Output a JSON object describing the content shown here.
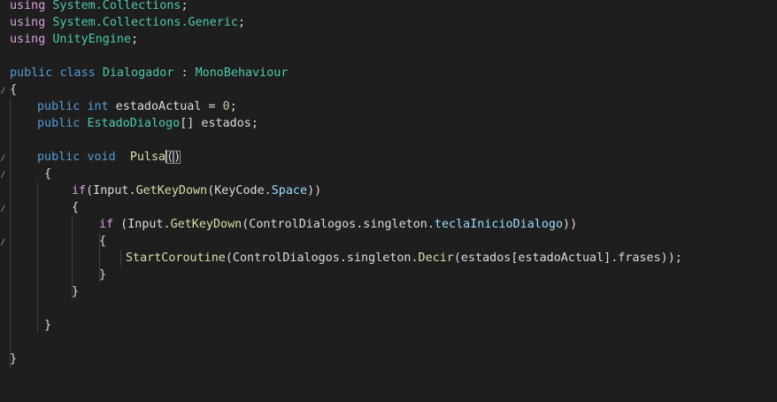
{
  "code": {
    "using_kw": "using",
    "ns1": "System.Collections",
    "ns2": "System.Collections.Generic",
    "ns3": "UnityEngine",
    "semi": ";",
    "public_kw": "public",
    "class_kw": "class",
    "class_name": "Dialogador",
    "colon": " : ",
    "base_class": "MonoBehaviour",
    "open_brace": "{",
    "close_brace": "}",
    "int_kw": "int",
    "field1_rest": " estadoActual = ",
    "field1_value": "0",
    "field2_type": "EstadoDialogo",
    "field2_rest": "[] estados;",
    "void_kw": "void",
    "method_name": "Pulsa",
    "open_paren": "(",
    "close_paren": ")",
    "if_kw": "if",
    "if1_rest_a": "(Input.",
    "getkeydown": "GetKeyDown",
    "if1_rest_b": "(KeyCode.",
    "space_member": "Space",
    "if1_rest_c": "))",
    "if2_rest_a": " (Input.",
    "if2_rest_b": "(ControlDialogos.singleton.",
    "tecla_member": "teclaInicioDialogo",
    "if2_rest_c": "))",
    "start_coroutine": "StartCoroutine",
    "call_rest_a": "(ControlDialogos.singleton.",
    "decir": "Decir",
    "call_rest_b": "(estados[estadoActual].frases));"
  }
}
